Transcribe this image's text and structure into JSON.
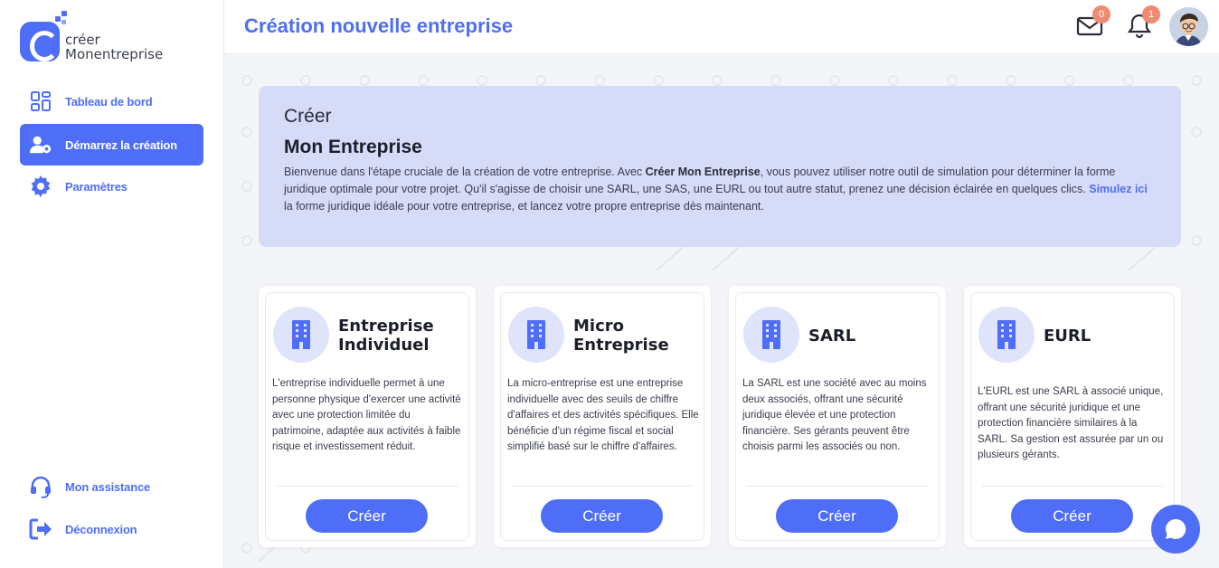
{
  "brand": {
    "line1": "créer",
    "line2": "Monentreprise"
  },
  "colors": {
    "accent": "#4f6ef7",
    "hero_bg": "#d6dbf8",
    "badge": "#ef8a73"
  },
  "sidebar": {
    "items": [
      {
        "label": "Tableau de bord",
        "icon": "dashboard-icon"
      },
      {
        "label": "Démarrez la création",
        "icon": "user-settings-icon",
        "active": true
      },
      {
        "label": "Paramètres",
        "icon": "gear-icon"
      }
    ],
    "bottom_items": [
      {
        "label": "Mon assistance",
        "icon": "headset-icon"
      },
      {
        "label": "Déconnexion",
        "icon": "logout-icon"
      }
    ]
  },
  "header": {
    "title": "Création nouvelle entreprise",
    "mail_count": "0",
    "notif_count": "1"
  },
  "hero": {
    "kicker": "Créer",
    "title": "Mon Entreprise",
    "text_part1": "Bienvenue dans l'étape cruciale de la création de votre entreprise. Avec ",
    "text_bold": "Créer Mon Entreprise",
    "text_part2": ", vous pouvez utiliser notre outil de simulation pour déterminer la forme juridique optimale pour votre projet. Qu'il s'agisse de choisir une SARL, une SAS, une EURL ou tout autre statut, prenez une décision éclairée en quelques clics. ",
    "link_text": "Simulez ici",
    "text_part3": " la forme juridique idéale pour votre entreprise, et lancez votre propre entreprise dès maintenant."
  },
  "cards": [
    {
      "title_line1": "Entreprise",
      "title_line2": "Individuel",
      "description": "L'entreprise individuelle permet à une personne physique d'exercer une activité avec une protection limitée du patrimoine, adaptée aux activités à faible risque et investissement réduit.",
      "button": "Créer"
    },
    {
      "title_line1": "Micro",
      "title_line2": "Entreprise",
      "description": "La micro-entreprise est une entreprise individuelle avec des seuils de chiffre d'affaires et des activités spécifiques. Elle bénéficie d'un régime fiscal et social simplifié basé sur le chiffre d'affaires.",
      "button": "Créer"
    },
    {
      "title_line1": "SARL",
      "title_line2": "",
      "description": "La SARL est une société avec au moins deux associés, offrant une sécurité juridique élevée et une protection financière. Ses gérants peuvent être choisis parmi les associés ou non.",
      "button": "Créer"
    },
    {
      "title_line1": "EURL",
      "title_line2": "",
      "description": "L'EURL est une SARL à associé unique, offrant une sécurité juridique et une protection financière similaires à la SARL. Sa gestion est assurée par un ou plusieurs gérants.",
      "button": "Créer"
    }
  ]
}
